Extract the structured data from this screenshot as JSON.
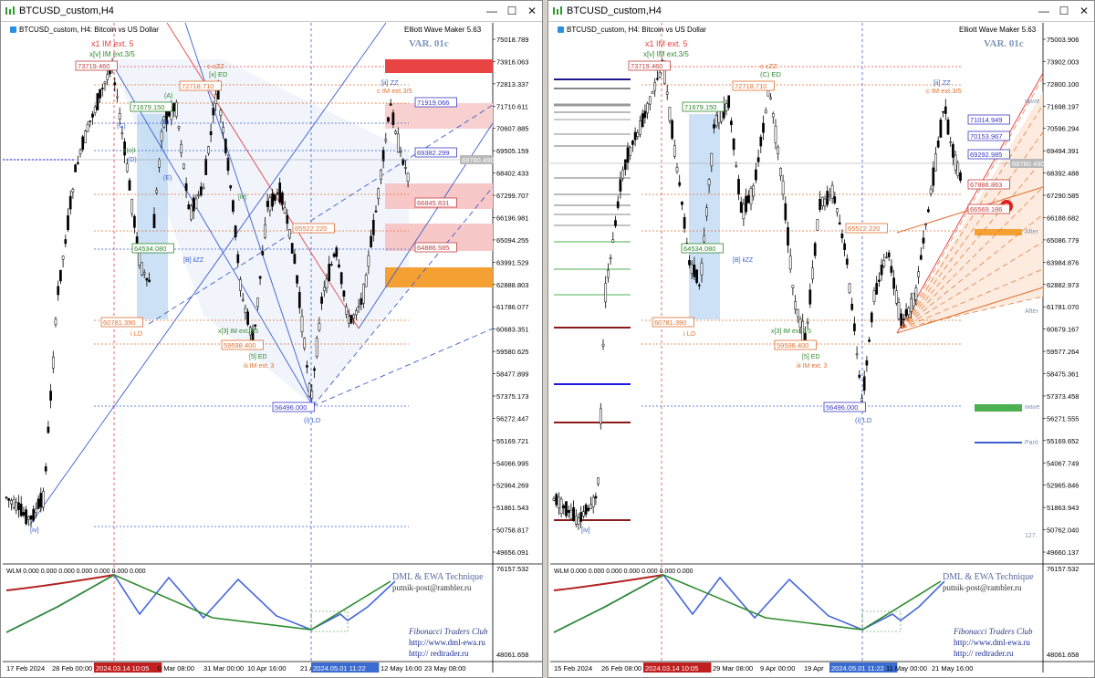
{
  "windows": [
    {
      "title": "BTCUSD_custom,H4",
      "chart_info": "BTCUSD_custom, H4:  Bitcoin vs US Dollar",
      "ewm": "Elliott Wave Maker 5.63",
      "var_label": "VAR. 01c",
      "y_labels": [
        "75018.789",
        "73916.063",
        "72813.337",
        "71710.611",
        "70607.885",
        "69505.159",
        "68402.433",
        "67299.707",
        "66196.981",
        "65094.255",
        "63991.529",
        "62888.803",
        "61786.077",
        "60683.351",
        "59580.625",
        "58477.899",
        "57375.173",
        "56272.447",
        "55169.721",
        "54066.995",
        "52964.269",
        "51861.543",
        "50758.817",
        "49656.091"
      ],
      "current_price": "68780.490",
      "indicator_labels": [
        "76157.532",
        "48061.658"
      ],
      "indicator_info": "WLM 0.000 0.000 0.000 0.000 0.000 0.000 0.000",
      "x_labels": [
        "17 Feb 2024",
        "28 Feb 00:00",
        "2024.03.14 10:05",
        "0 Mar 08:00",
        "31 Mar 00:00",
        "10 Apr 16:00",
        "21 A",
        "2024.05.01 11:22",
        "12 May 16:00",
        "23 May 08:00"
      ],
      "footer": [
        "DML & EWA Technique",
        "putnik-post@rambler.ru",
        "Fibonacci Traders Club",
        "http://www.dml-ewa.ru",
        "http:// redtrader.ru"
      ],
      "wave_labels": [
        "x1 IM ext. 5",
        "x[v] IM ext.3/5",
        "73719.460",
        "c cZZ",
        "[x] ED",
        "72718.710",
        "[ii] ZZ",
        "c IM ext.3/5",
        "71919.066",
        "71679.150",
        "69382.299",
        "(A)",
        "(B)",
        "(C)",
        "(D)",
        "(E)",
        "x(c)I",
        "66845.831",
        "65522.220",
        "64534.080",
        "64886.585",
        "[B] iiZZ",
        "[iv]",
        "60781.390",
        "i LD",
        "x[3] IM ext.3/5",
        "59598.400",
        "[5] ED",
        "iii IM ext. 3",
        "56496.000",
        "(i) LD",
        "[iv]"
      ]
    },
    {
      "title": "BTCUSD_custom,H4",
      "chart_info": "BTCUSD_custom, H4:  Bitcoin vs US Dollar",
      "ewm": "Elliott Wave Maker 5.63",
      "var_label": "VAR. 01c",
      "y_labels": [
        "75003.906",
        "73902.003",
        "72800.100",
        "71698.197",
        "70596.294",
        "69494.391",
        "68392.488",
        "67290.585",
        "66188.682",
        "65086.779",
        "63984.876",
        "62882.973",
        "61781.070",
        "60679.167",
        "59577.264",
        "58475.361",
        "57373.458",
        "56271.555",
        "55169.652",
        "54067.749",
        "52965.846",
        "51863.943",
        "50762.040",
        "49660.137"
      ],
      "current_price": "68780.490",
      "indicator_labels": [
        "76157.532",
        "48061.658"
      ],
      "indicator_info": "WLM 0.000 0.000 0.000 0.000 0.000 0.000 0.000",
      "x_labels": [
        "15 Feb 2024",
        "26 Feb 08:00",
        "2024.03.14 10:05",
        "29 Mar 08:00",
        "9 Apr 00:00",
        "19 Apr",
        "2024.05.01 11:22",
        "11 May 00:00",
        "21 May 16:00"
      ],
      "footer": [
        "DML & EWA Technique",
        "putnik-post@rambler.ru",
        "Fibonacci Traders Club",
        "http://www.dml-ewa.ru",
        "http:// redtrader.ru"
      ],
      "side_labels": [
        "wave",
        "After",
        "After",
        "wave",
        "Parit",
        "127."
      ],
      "wave_labels": [
        "x1 IM ext. 5",
        "x[v] IM ext.3/5",
        "73719.460",
        "c cZZ",
        "(C) ED",
        "72718.710",
        "[ii] ZZ",
        "c IM ext.3/5",
        "71014.949",
        "70153.967",
        "69292.985",
        "67886.863",
        "66569.186",
        "71679.150",
        "65522.220",
        "64534.080",
        "[B] iiZZ",
        "60781.390",
        "i LD",
        "x[3] IM ext.3/5",
        "59598.400",
        "[5] ED",
        "iii IM ext. 3",
        "56496.000",
        "(i) LD",
        "[iv]",
        "5"
      ]
    }
  ],
  "colors": {
    "up": "#000000",
    "red_zone": "#e84444",
    "pink_zone": "#f8c8c8",
    "orange_zone": "#f5a033",
    "green_zone": "#4caf50",
    "blue_line": "#3a5fcd",
    "indicator_red": "#b22222",
    "indicator_blue": "#4466dd",
    "indicator_green": "#2e8b2e"
  }
}
